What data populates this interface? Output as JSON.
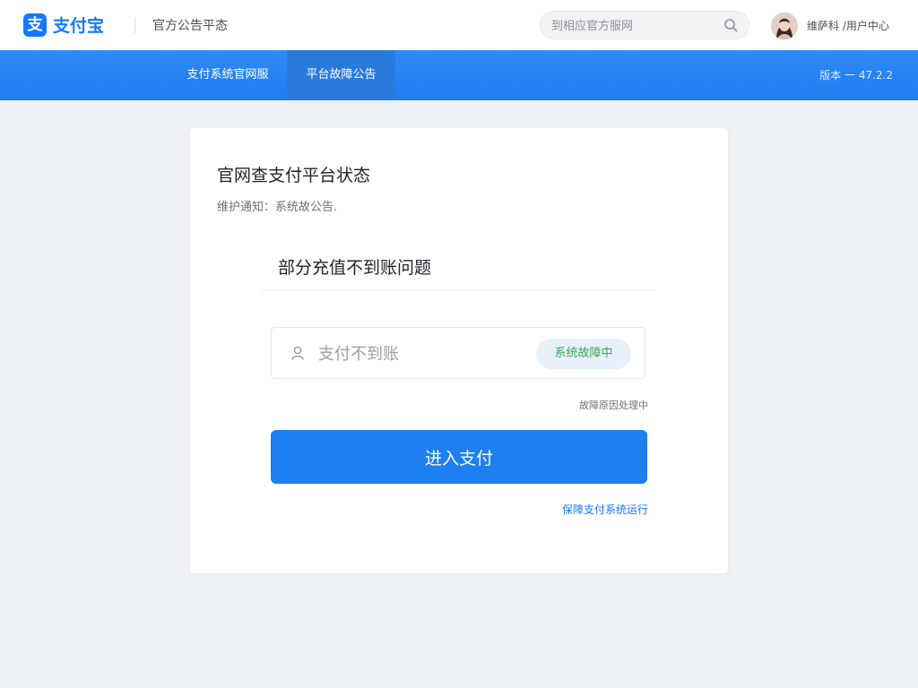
{
  "header": {
    "logo_glyph": "支",
    "logo_text": "支付宝",
    "subtitle": "官方公告平态",
    "search_placeholder": "到相应官方服网",
    "user_text": "维萨科 /用户中心"
  },
  "nav": {
    "items": [
      {
        "label": "支付系统官网服"
      },
      {
        "label": "平台故障公告"
      }
    ],
    "version": "版本 一 47.2.2"
  },
  "card": {
    "title": "官网查支付平台状态",
    "notice": "维护通知：系统故公告.",
    "issue_title": "部分充值不到账问题",
    "account_placeholder": "支付不到账",
    "status_badge": "系统故障中",
    "hint": "故障原因处理中",
    "enter_button": "进入支付",
    "footer_link": "保障支付系统运行"
  },
  "colors": {
    "brand": "#1677ff",
    "nav_bg": "#1f7df0",
    "page_bg": "#eef1f6",
    "badge_text": "#3aa45a"
  }
}
